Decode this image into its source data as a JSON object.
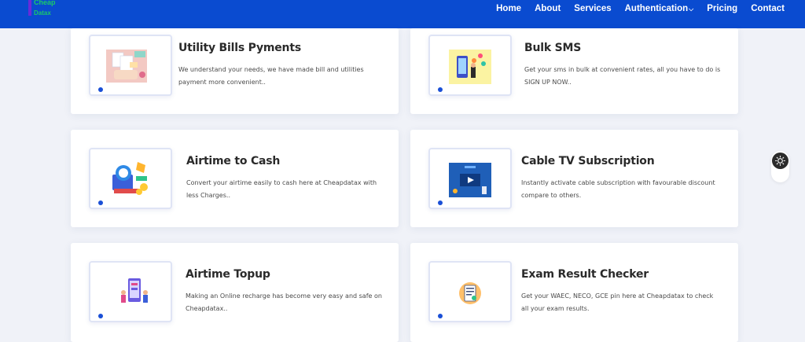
{
  "brand": {
    "line1": "Cheap",
    "line2": "Datax"
  },
  "nav": {
    "items": [
      "Home",
      "About",
      "Services",
      "Authentication",
      "Pricing",
      "Contact"
    ]
  },
  "services": [
    {
      "title": "Utility Bills Pyments",
      "desc": "We understand your needs, we have made bill and utilities payment more convenient.."
    },
    {
      "title": "Bulk SMS",
      "desc": "Get your sms in bulk at convenient rates, all you have to do is SIGN UP NOW.."
    },
    {
      "title": "Airtime to Cash",
      "desc": "Convert your airtime easily to cash here at Cheapdatax with less Charges.."
    },
    {
      "title": "Cable TV Subscription",
      "desc": "Instantly activate cable subscription with favourable discount compare to others."
    },
    {
      "title": "Airtime Topup",
      "desc": "Making an Online recharge has become very easy and safe on Cheapdatax.."
    },
    {
      "title": "Exam Result Checker",
      "desc": "Get your WAEC, NECO, GCE pin here at Cheapdatax to check all your exam results."
    }
  ],
  "icons": {
    "theme_toggle": "sun-icon",
    "card_images": [
      "bill-payment-illustration-icon",
      "bulk-sms-illustration-icon",
      "airtime-cash-illustration-icon",
      "cable-tv-illustration-icon",
      "airtime-topup-illustration-icon",
      "exam-checker-illustration-icon"
    ]
  },
  "colors": {
    "nav_bg": "#0a4bd0",
    "accent": "#1a4fd6",
    "page_bg": "#f0f2f8",
    "logo_text": "#1ac96a"
  }
}
